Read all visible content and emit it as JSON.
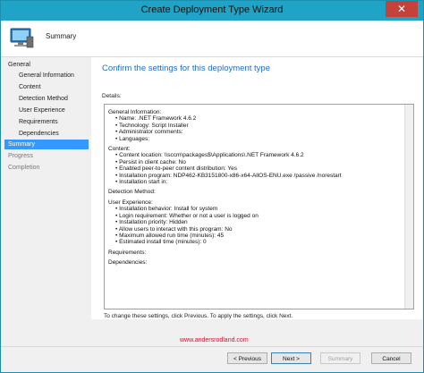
{
  "window": {
    "title": "Create Deployment Type Wizard",
    "close_glyph": "✕"
  },
  "header": {
    "title": "Summary",
    "icon": "computer-icon"
  },
  "nav": {
    "items": [
      {
        "label": "General",
        "level": 0,
        "state": "normal"
      },
      {
        "label": "General Information",
        "level": 1,
        "state": "normal"
      },
      {
        "label": "Content",
        "level": 1,
        "state": "normal"
      },
      {
        "label": "Detection Method",
        "level": 1,
        "state": "normal"
      },
      {
        "label": "User Experience",
        "level": 1,
        "state": "normal"
      },
      {
        "label": "Requirements",
        "level": 1,
        "state": "normal"
      },
      {
        "label": "Dependencies",
        "level": 1,
        "state": "normal"
      },
      {
        "label": "Summary",
        "level": 0,
        "state": "active"
      },
      {
        "label": "Progress",
        "level": 0,
        "state": "dim"
      },
      {
        "label": "Completion",
        "level": 0,
        "state": "dim"
      }
    ]
  },
  "main": {
    "heading": "Confirm the settings for this deployment type",
    "details_label": "Details:",
    "details_lines": [
      {
        "text": "General Information:",
        "bullet": false
      },
      {
        "text": "Name: .NET Framework 4.6.2",
        "bullet": true
      },
      {
        "text": "Technology: Script Installer",
        "bullet": true
      },
      {
        "text": "Administrator comments:",
        "bullet": true
      },
      {
        "text": "Languages:",
        "bullet": true
      },
      {
        "text": "",
        "bullet": false
      },
      {
        "text": "Content:",
        "bullet": false
      },
      {
        "text": "Content location: \\\\sccm\\packages$\\Applications\\.NET Framework 4.6.2",
        "bullet": true
      },
      {
        "text": "Persist in client cache: No",
        "bullet": true
      },
      {
        "text": "Enabled peer-to-peer content distribution: Yes",
        "bullet": true
      },
      {
        "text": "Installation program: NDP462-KB3151800-x86-x64-AllOS-ENU.exe /passive /norestart",
        "bullet": true
      },
      {
        "text": "Installation start in:",
        "bullet": true
      },
      {
        "text": "",
        "bullet": false
      },
      {
        "text": "Detection Method:",
        "bullet": false
      },
      {
        "text": "",
        "bullet": false
      },
      {
        "text": "User Experience:",
        "bullet": false
      },
      {
        "text": "Installation behavior: Install for system",
        "bullet": true
      },
      {
        "text": "Login requirement: Whether or not a user is logged on",
        "bullet": true
      },
      {
        "text": "Installation priority: Hidden",
        "bullet": true
      },
      {
        "text": "Allow users to interact with this program: No",
        "bullet": true
      },
      {
        "text": "Maximum allowed run time (minutes): 45",
        "bullet": true
      },
      {
        "text": "Estimated install time (minutes): 0",
        "bullet": true
      },
      {
        "text": "",
        "bullet": false
      },
      {
        "text": "Requirements:",
        "bullet": false
      },
      {
        "text": "",
        "bullet": false
      },
      {
        "text": "Dependencies:",
        "bullet": false
      }
    ],
    "hint": "To change these settings, click Previous. To apply the settings, click Next."
  },
  "watermark": "www.andersrodland.com",
  "footer": {
    "previous": "< Previous",
    "next": "Next >",
    "summary": "Summary",
    "cancel": "Cancel"
  }
}
